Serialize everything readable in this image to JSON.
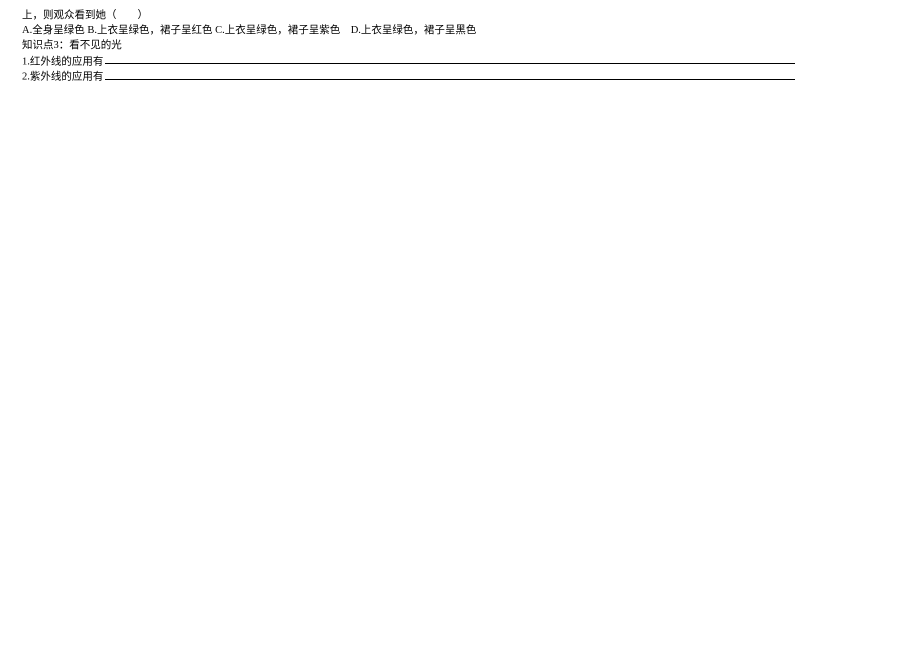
{
  "q_stem_tail": "上，则观众看到她（　　）",
  "choices_line": "A.全身呈绿色 B.上衣呈绿色，裙子呈红色 C.上衣呈绿色，裙子呈紫色　D.上衣呈绿色，裙子呈黑色",
  "section_heading": "知识点3：看不见的光",
  "item1_prefix": "1.红外线的应用有",
  "item2_prefix": "2.紫外线的应用有"
}
